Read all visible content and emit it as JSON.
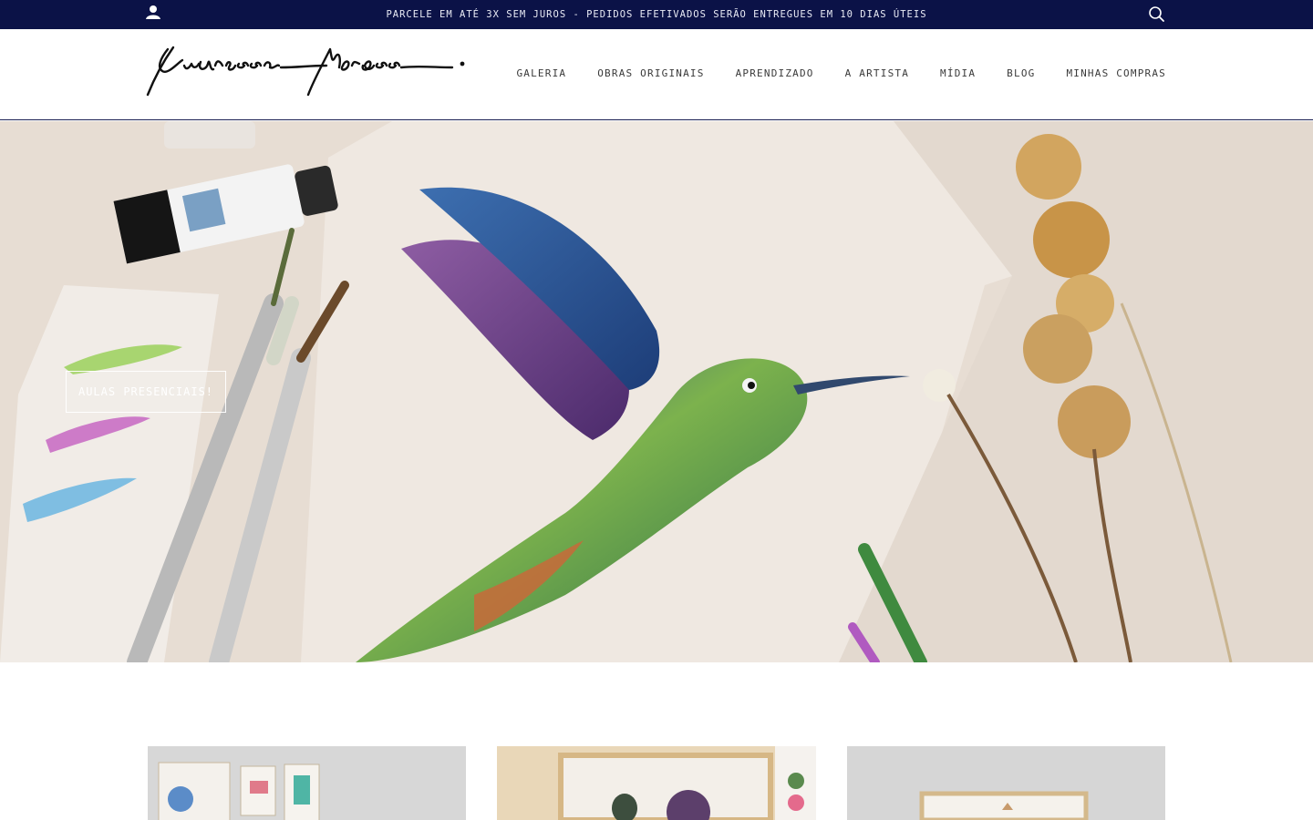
{
  "topbar": {
    "message": "PARCELE EM ATÉ 3X SEM JUROS - PEDIDOS EFETIVADOS SERÃO ENTREGUES EM 10 DIAS ÚTEIS",
    "account_icon": "user-icon",
    "search_icon": "search-icon"
  },
  "brand": {
    "logo_text": "Andressa Moraes"
  },
  "nav": {
    "items": [
      {
        "label": "GALERIA"
      },
      {
        "label": "OBRAS ORIGINAIS"
      },
      {
        "label": "APRENDIZADO"
      },
      {
        "label": "A ARTISTA"
      },
      {
        "label": "MÍDIA"
      },
      {
        "label": "BLOG"
      },
      {
        "label": "MINHAS COMPRAS"
      }
    ]
  },
  "hero": {
    "cta_label": "AULAS PRESENCIAIS!"
  },
  "colors": {
    "topbar_bg": "#0b1247",
    "hero_bg": "#e6dcd2",
    "accent": "#1a1f52"
  }
}
